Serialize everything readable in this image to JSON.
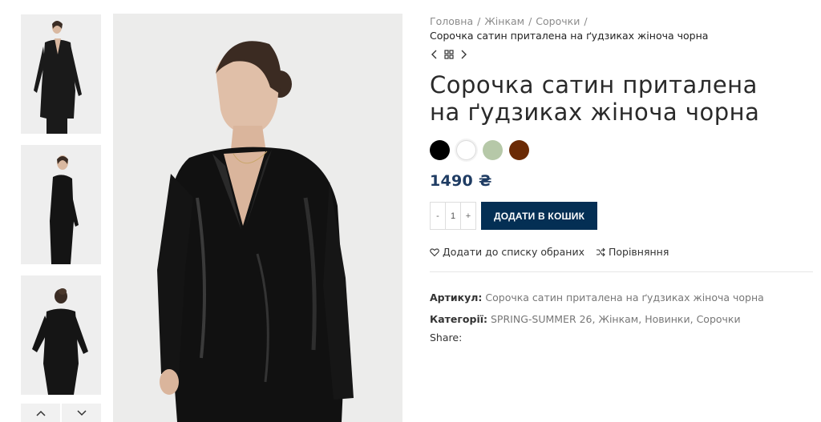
{
  "breadcrumb": {
    "items": [
      "Головна",
      "Жінкам",
      "Сорочки"
    ],
    "separator": "/",
    "current": "Сорочка сатин приталена на ґудзиках жіноча чорна"
  },
  "product": {
    "title": "Сорочка сатин приталена на ґудзиках жіноча чорна",
    "price": "1490 ₴",
    "swatches": [
      "black",
      "white",
      "sage",
      "brown"
    ],
    "swatch_colors": {
      "black": "#000000",
      "white": "#ffffff",
      "sage": "#b6c8a8",
      "brown": "#6b2a05"
    },
    "quantity": "1",
    "qty_minus": "-",
    "qty_plus": "+",
    "add_to_cart": "ДОДАТИ В КОШИК",
    "wishlist": "Додати до списку обраних",
    "compare": "Порівняння",
    "sku_label": "Артикул:",
    "sku_value": "Сорочка сатин приталена на ґудзиках жіноча чорна",
    "categories_label": "Категорії:",
    "categories": [
      "SPRING-SUMMER 26",
      "Жінкам",
      "Новинки",
      "Сорочки"
    ],
    "category_separator": ",",
    "share_label": "Share:"
  },
  "colors": {
    "accent": "#042f54",
    "price": "#1f3c63"
  },
  "icons": [
    "chevron-left-icon",
    "grid-icon",
    "chevron-right-icon",
    "heart-icon",
    "shuffle-icon",
    "chevron-up-icon",
    "chevron-down-icon"
  ]
}
